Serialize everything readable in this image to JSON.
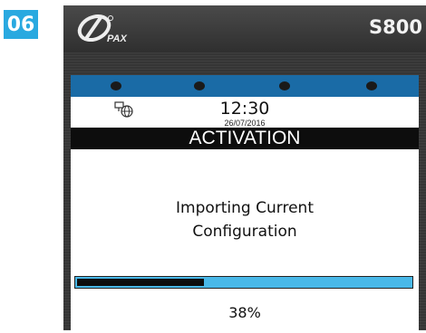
{
  "step": {
    "number": "06",
    "color": "#29a9e0"
  },
  "device": {
    "brand": "PAX",
    "model": "S800"
  },
  "header": {
    "icon": "network-globe-icon",
    "time": "12:30",
    "date": "26/07/2016"
  },
  "title": "ACTIVATION",
  "message": {
    "line1": "Importing Current",
    "line2": "Configuration"
  },
  "progress": {
    "value": 0.38,
    "label": "38%"
  },
  "colors": {
    "status_strip": "#1a6ba6",
    "progress_track": "#49b8e8",
    "progress_fill": "#0d0d0d"
  }
}
